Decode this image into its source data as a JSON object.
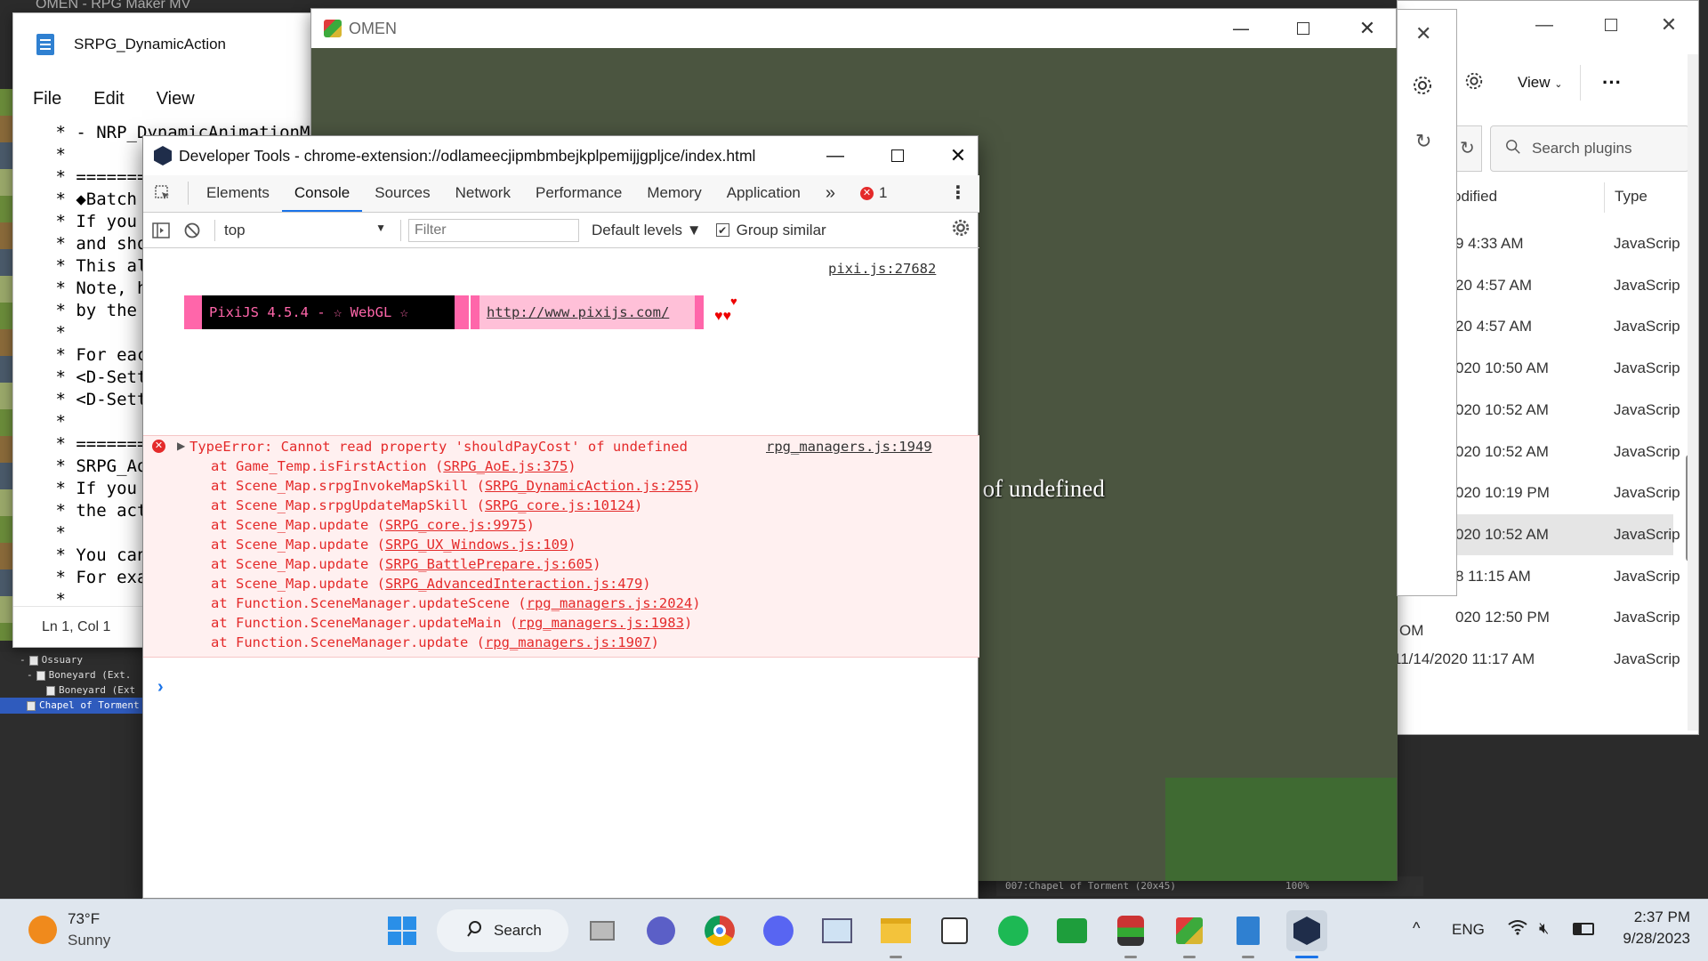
{
  "background_app": {
    "title": "OMEN - RPG Maker MV",
    "map_tree": [
      {
        "label": "Ossuary",
        "selected": false
      },
      {
        "label": "Boneyard (Ext.",
        "selected": false
      },
      {
        "label": "Boneyard (Ext",
        "selected": false
      },
      {
        "label": "Chapel of Torment",
        "selected": true
      }
    ],
    "status_map": "007:Chapel of Torment (20x45)",
    "status_zoom": "100%"
  },
  "notepad": {
    "title": "SRPG_DynamicAction",
    "menu": [
      "File",
      "Edit",
      "View"
    ],
    "lines": [
      " * - NRP_DynamicAnimationM",
      " *",
      " * =======",
      " * ◆Batch",
      " * If you",
      " * and sho",
      " * This al",
      " * Note, h",
      " * by the ",
      " *",
      " * For eac",
      " * <D-Sett",
      " * <D-Sett",
      " *",
      " * =======",
      " * SRPG_Ao",
      " * If you ",
      " * the act",
      " *",
      " * You can",
      " * For exa",
      " *"
    ],
    "status": "Ln 1, Col 1"
  },
  "game_window": {
    "title": "OMEN",
    "overlay_text": "' of undefined"
  },
  "explorer": {
    "toolbar_view": "View",
    "search_placeholder": "Search plugins",
    "col_modified": "odified",
    "col_type": "Type",
    "rows": [
      {
        "date": "9 4:33 AM",
        "type": "JavaScrip"
      },
      {
        "date": "20 4:57 AM",
        "type": "JavaScrip"
      },
      {
        "date": "20 4:57 AM",
        "type": "JavaScrip"
      },
      {
        "date": "020 10:50 AM",
        "type": "JavaScrip"
      },
      {
        "date": "020 10:52 AM",
        "type": "JavaScrip"
      },
      {
        "date": "020 10:52 AM",
        "type": "JavaScrip"
      },
      {
        "date": "020 10:19 PM",
        "type": "JavaScrip"
      },
      {
        "date": "020 10:52 AM",
        "type": "JavaScrip",
        "selected": true
      },
      {
        "date": "8 11:15 AM",
        "type": "JavaScrip"
      },
      {
        "date": "020 12:50 PM",
        "type": "JavaScrip"
      },
      {
        "date": "11/14/2020 11:17 AM",
        "type": "JavaScrip"
      }
    ],
    "partial_left": "OM"
  },
  "devtools": {
    "title": "Developer Tools - chrome-extension://odlameecjipmbmbejkplpemijjgpljce/index.html",
    "tabs": [
      "Elements",
      "Console",
      "Sources",
      "Network",
      "Performance",
      "Memory",
      "Application"
    ],
    "active_tab": "Console",
    "more_tabs": "»",
    "error_count": "1",
    "context": "top",
    "filter_placeholder": "Filter",
    "levels": "Default levels ▼",
    "group_similar": "Group similar",
    "pixi_source": "pixi.js:27682",
    "pixi_banner": "PixiJS 4.5.4 - ☆ WebGL ☆",
    "pixi_url": "http://www.pixijs.com/",
    "hearts": "♥♥",
    "heart_top": "♥",
    "error_message": "TypeError: Cannot read property 'shouldPayCost' of undefined",
    "error_source": "rpg_managers.js:1949",
    "stack": [
      {
        "fn": "at Game_Temp.isFirstAction",
        "file": "SRPG_AoE.js:375"
      },
      {
        "fn": "at Scene_Map.srpgInvokeMapSkill",
        "file": "SRPG_DynamicAction.js:255"
      },
      {
        "fn": "at Scene_Map.srpgUpdateMapSkill",
        "file": "SRPG_core.js:10124"
      },
      {
        "fn": "at Scene_Map.update",
        "file": "SRPG_core.js:9975"
      },
      {
        "fn": "at Scene_Map.update",
        "file": "SRPG_UX_Windows.js:109"
      },
      {
        "fn": "at Scene_Map.update",
        "file": "SRPG_BattlePrepare.js:605"
      },
      {
        "fn": "at Scene_Map.update",
        "file": "SRPG_AdvancedInteraction.js:479"
      },
      {
        "fn": "at Function.SceneManager.updateScene",
        "file": "rpg_managers.js:2024"
      },
      {
        "fn": "at Function.SceneManager.updateMain",
        "file": "rpg_managers.js:1983"
      },
      {
        "fn": "at Function.SceneManager.update",
        "file": "rpg_managers.js:1907"
      }
    ],
    "prompt": "›"
  },
  "taskbar": {
    "weather_temp": "73°F",
    "weather_desc": "Sunny",
    "search_label": "Search",
    "lang": "ENG",
    "time": "2:37 PM",
    "date": "9/28/2023"
  },
  "colors": {
    "devtools_error": "#e42a2a",
    "accent": "#1a73e8",
    "pixi_pink": "#ff66aa"
  }
}
